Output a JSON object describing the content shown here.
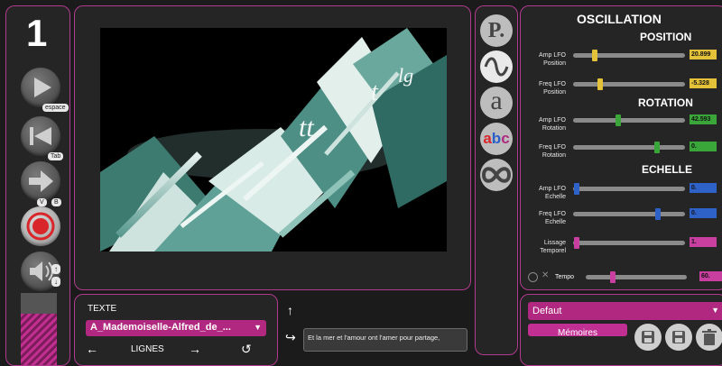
{
  "track_number": "1",
  "transport": {
    "play_key": "espace",
    "next_key": "Tab",
    "rec_key_v": "V",
    "rec_key_b": "B"
  },
  "level_meter": {
    "level": 0.72
  },
  "text_panel": {
    "title": "TEXTE",
    "selected_file": "A_Mademoiselle-Alfred_de_...",
    "lines_label": "LIGNES",
    "current_line": "Et la mer et l'amour ont l'amer pour partage,"
  },
  "modes": [
    "P.",
    "wave",
    "a",
    "abc",
    "infinity"
  ],
  "oscillation": {
    "title": "OSCILLATION",
    "position": {
      "title": "POSITION",
      "amp": {
        "label1": "Amp LFO",
        "label2": "Position",
        "value": "20.899",
        "level": 0.18,
        "color": "#e3c23a"
      },
      "freq": {
        "label1": "Freq LFO",
        "label2": "Position",
        "value": "-5.328",
        "level": 0.23,
        "color": "#e3c23a"
      }
    },
    "rotation": {
      "title": "ROTATION",
      "amp": {
        "label1": "Amp LFO",
        "label2": "Rotation",
        "value": "42.593",
        "level": 0.4,
        "color": "#3aa63a"
      },
      "freq": {
        "label1": "Freq LFO",
        "label2": "Rotation",
        "value": "0.",
        "level": 0.76,
        "color": "#3aa63a"
      }
    },
    "echelle": {
      "title": "ECHELLE",
      "amp": {
        "label1": "Amp LFO",
        "label2": "Echelle",
        "value": "0.",
        "level": 0.01,
        "color": "#2f62c8"
      },
      "freq": {
        "label1": "Freq LFO",
        "label2": "Echelle",
        "value": "0.",
        "level": 0.77,
        "color": "#2f62c8"
      },
      "lissage": {
        "label1": "Lissage",
        "label2": "Temporel",
        "value": "1.",
        "level": 0.01,
        "color": "#c93fa0"
      }
    },
    "tempo": {
      "label": "Tempo",
      "value": "60.",
      "level": 0.25,
      "color": "#c93fa0"
    }
  },
  "memory": {
    "preset": "Defaut",
    "button": "Mémoires"
  }
}
